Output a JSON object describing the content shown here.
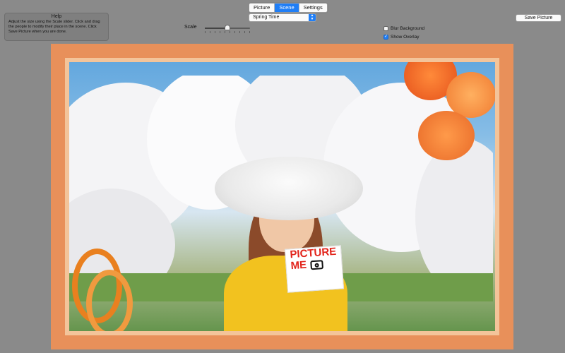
{
  "tabs": [
    {
      "label": "Picture",
      "active": false
    },
    {
      "label": "Scene",
      "active": true
    },
    {
      "label": "Settings",
      "active": false
    }
  ],
  "help": {
    "title": "Help",
    "body": "Adjust the size using the Scale slider. Click and drag the people to modify their place in the scene. Click Save Picture when you are done."
  },
  "scene_select": {
    "value": "Spring Time",
    "icon": "select-arrows-icon"
  },
  "scale": {
    "label": "Scale",
    "value_fraction": 0.5
  },
  "checkboxes": {
    "blur_background": {
      "label": "Blur Background",
      "checked": false
    },
    "show_overlay": {
      "label": "Show Overlay",
      "checked": true
    }
  },
  "save_button": {
    "label": "Save Picture"
  },
  "sign": {
    "line1": "PICTURE",
    "line2": "ME",
    "icon": "camera-icon"
  },
  "colors": {
    "accent": "#1f7ef6",
    "window_bg": "#8a8a8a",
    "frame": "#e8905a"
  }
}
